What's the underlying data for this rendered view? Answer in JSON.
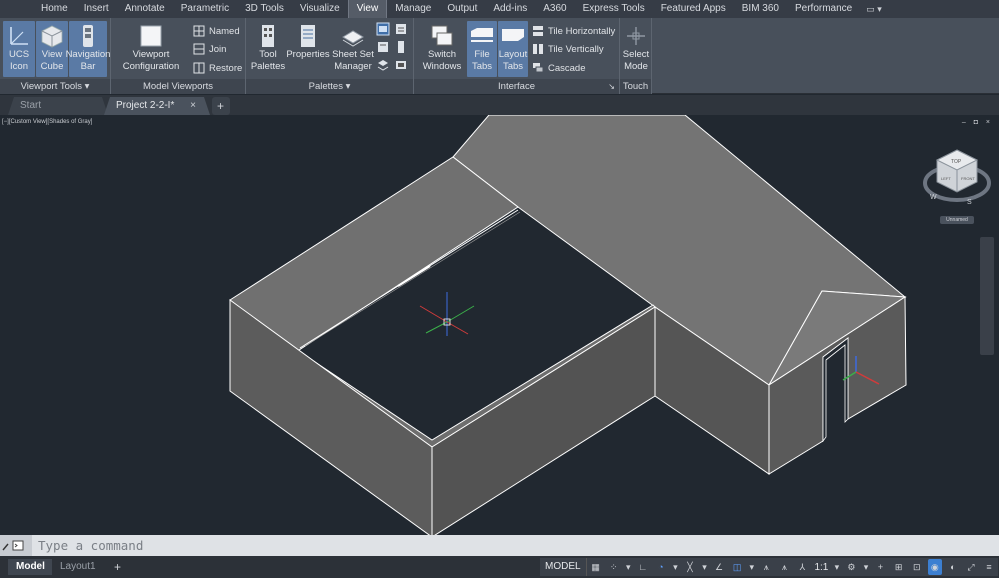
{
  "ribbon": {
    "tabs": [
      "Home",
      "Insert",
      "Annotate",
      "Parametric",
      "3D Tools",
      "Visualize",
      "View",
      "Manage",
      "Output",
      "Add-ins",
      "A360",
      "Express Tools",
      "Featured Apps",
      "BIM 360",
      "Performance"
    ],
    "active_tab": "View",
    "panels": {
      "viewport_tools": {
        "title": "Viewport Tools",
        "ucs_icon": "UCS\nIcon",
        "view_cube": "View\nCube",
        "navigation_bar": "Navigation\nBar"
      },
      "model_viewports": {
        "title": "Model Viewports",
        "viewport_configuration": "Viewport\nConfiguration",
        "named": "Named",
        "join": "Join",
        "restore": "Restore"
      },
      "palettes": {
        "title": "Palettes",
        "tool_palettes": "Tool\nPalettes",
        "properties": "Properties",
        "sheet_set_manager": "Sheet Set\nManager"
      },
      "interface": {
        "title": "Interface",
        "switch_windows": "Switch\nWindows",
        "file_tabs": "File\nTabs",
        "layout_tabs": "Layout\nTabs",
        "tile_horizontally": "Tile Horizontally",
        "tile_vertically": "Tile Vertically",
        "cascade": "Cascade"
      },
      "touch": {
        "title": "Touch",
        "select_mode": "Select\nMode"
      }
    }
  },
  "file_tabs": {
    "start": "Start",
    "project": "Project 2-2-I*",
    "close_glyph": "×",
    "add_glyph": "+"
  },
  "viewport": {
    "label": "[−][Custom View][Shades of Gray]",
    "controls": "– ◘ ×",
    "viewcube_face": "TOP",
    "viewcube_front": "LEFT",
    "viewcube_right": "FRONT",
    "compass_west": "W",
    "compass_south": "S",
    "ucs_menu": "Unnamed"
  },
  "command_line": {
    "placeholder": "Type a command"
  },
  "status_bar": {
    "model_tab": "Model",
    "layout_tab": "Layout1",
    "add_glyph": "+",
    "model_button": "MODEL",
    "scale": "1:1"
  },
  "colors": {
    "tab_bar": "#363c46",
    "ribbon": "#48505b",
    "drawing_background": "#212830",
    "roof_shade": "#747474",
    "wall_shade": "#585858",
    "highlight": "#5a7aa5"
  }
}
